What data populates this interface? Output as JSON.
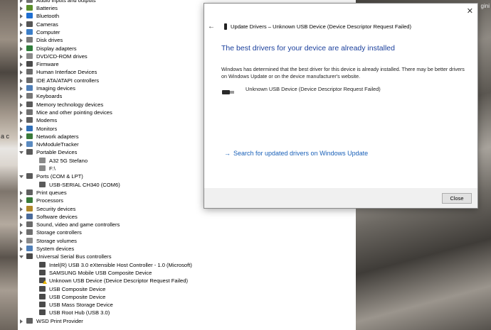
{
  "desktop": {
    "left_fragment": "a c",
    "right_fragment": "gini"
  },
  "tree": {
    "items": [
      {
        "label": "Audio inputs and outputs",
        "level": 0,
        "expand": "closed",
        "color": "#707070"
      },
      {
        "label": "Batteries",
        "level": 0,
        "expand": "closed",
        "color": "#5a8f2a"
      },
      {
        "label": "Bluetooth",
        "level": 0,
        "expand": "closed",
        "color": "#1f6fd1"
      },
      {
        "label": "Cameras",
        "level": 0,
        "expand": "closed",
        "color": "#555555"
      },
      {
        "label": "Computer",
        "level": 0,
        "expand": "closed",
        "color": "#3b7ec8"
      },
      {
        "label": "Disk drives",
        "level": 0,
        "expand": "closed",
        "color": "#7a7a7a"
      },
      {
        "label": "Display adapters",
        "level": 0,
        "expand": "closed",
        "color": "#2f7d3a"
      },
      {
        "label": "DVD/CD-ROM drives",
        "level": 0,
        "expand": "closed",
        "color": "#8a8a8a"
      },
      {
        "label": "Firmware",
        "level": 0,
        "expand": "closed",
        "color": "#4a4a4a"
      },
      {
        "label": "Human Interface Devices",
        "level": 0,
        "expand": "closed",
        "color": "#6b6b6b"
      },
      {
        "label": "IDE ATA/ATAPI controllers",
        "level": 0,
        "expand": "closed",
        "color": "#6a6a6a"
      },
      {
        "label": "Imaging devices",
        "level": 0,
        "expand": "closed",
        "color": "#4f7fb8"
      },
      {
        "label": "Keyboards",
        "level": 0,
        "expand": "closed",
        "color": "#777777"
      },
      {
        "label": "Memory technology devices",
        "level": 0,
        "expand": "closed",
        "color": "#5a5a5a"
      },
      {
        "label": "Mice and other pointing devices",
        "level": 0,
        "expand": "closed",
        "color": "#707070"
      },
      {
        "label": "Modems",
        "level": 0,
        "expand": "closed",
        "color": "#606060"
      },
      {
        "label": "Monitors",
        "level": 0,
        "expand": "closed",
        "color": "#2f6fb8"
      },
      {
        "label": "Network adapters",
        "level": 0,
        "expand": "closed",
        "color": "#3a7a3a"
      },
      {
        "label": "NvModuleTracker",
        "level": 0,
        "expand": "closed",
        "color": "#5a8ac0"
      },
      {
        "label": "Portable Devices",
        "level": 0,
        "expand": "open",
        "color": "#5a5a5a"
      },
      {
        "label": "A32 5G Stefano",
        "level": 1,
        "expand": "none",
        "color": "#8a8a8a"
      },
      {
        "label": "F:\\",
        "level": 1,
        "expand": "none",
        "color": "#8a8a8a"
      },
      {
        "label": "Ports (COM & LPT)",
        "level": 0,
        "expand": "open",
        "color": "#5a5a5a"
      },
      {
        "label": "USB-SERIAL CH340 (COM6)",
        "level": 1,
        "expand": "none",
        "color": "#5a5a5a"
      },
      {
        "label": "Print queues",
        "level": 0,
        "expand": "closed",
        "color": "#606060"
      },
      {
        "label": "Processors",
        "level": 0,
        "expand": "closed",
        "color": "#3a7a3a"
      },
      {
        "label": "Security devices",
        "level": 0,
        "expand": "closed",
        "color": "#b0882a"
      },
      {
        "label": "Software devices",
        "level": 0,
        "expand": "closed",
        "color": "#4a6a9a"
      },
      {
        "label": "Sound, video and game controllers",
        "level": 0,
        "expand": "closed",
        "color": "#6a6a6a"
      },
      {
        "label": "Storage controllers",
        "level": 0,
        "expand": "closed",
        "color": "#6f6f6f"
      },
      {
        "label": "Storage volumes",
        "level": 0,
        "expand": "closed",
        "color": "#8a8a8a"
      },
      {
        "label": "System devices",
        "level": 0,
        "expand": "closed",
        "color": "#4f7fb8"
      },
      {
        "label": "Universal Serial Bus controllers",
        "level": 0,
        "expand": "open",
        "color": "#4a4a4a"
      },
      {
        "label": "Intel(R) USB 3.0 eXtensible Host Controller - 1.0 (Microsoft)",
        "level": 1,
        "expand": "none",
        "color": "#4a4a4a"
      },
      {
        "label": "SAMSUNG Mobile USB Composite Device",
        "level": 1,
        "expand": "none",
        "color": "#4a4a4a"
      },
      {
        "label": "Unknown USB Device (Device Descriptor Request Failed)",
        "level": 1,
        "expand": "none",
        "color": "#4a4a4a",
        "warning": true
      },
      {
        "label": "USB Composite Device",
        "level": 1,
        "expand": "none",
        "color": "#4a4a4a"
      },
      {
        "label": "USB Composite Device",
        "level": 1,
        "expand": "none",
        "color": "#4a4a4a"
      },
      {
        "label": "USB Mass Storage Device",
        "level": 1,
        "expand": "none",
        "color": "#4a4a4a"
      },
      {
        "label": "USB Root Hub (USB 3.0)",
        "level": 1,
        "expand": "none",
        "color": "#4a4a4a"
      },
      {
        "label": "WSD Print Provider",
        "level": 0,
        "expand": "closed",
        "color": "#606060"
      }
    ]
  },
  "dialog": {
    "title": "Update Drivers – Unknown USB Device (Device Descriptor Request Failed)",
    "close_glyph": "✕",
    "back_glyph": "←",
    "heading": "The best drivers for your device are already installed",
    "body": "Windows has determined that the best driver for this device is already installed. There may be better drivers on Windows Update or on the device manufacturer's website.",
    "device_name": "Unknown USB Device (Device Descriptor Request Failed)",
    "link_arrow": "→",
    "link_text": "Search for updated drivers on Windows Update",
    "close_button_label": "Close",
    "colors": {
      "heading": "#1a3f9c",
      "link": "#1960b8"
    }
  }
}
